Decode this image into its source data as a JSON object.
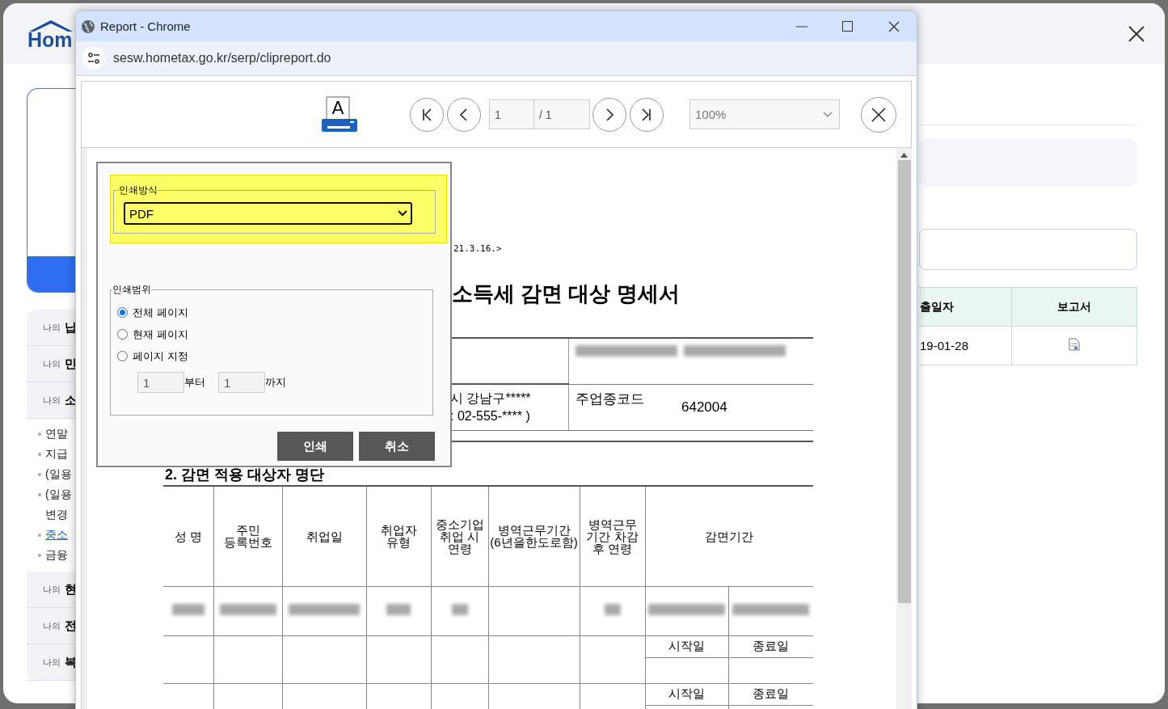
{
  "back_page": {
    "logo": "Hom",
    "nav": [
      {
        "prefix": "나의",
        "label": "납"
      },
      {
        "prefix": "나의",
        "label": "민"
      },
      {
        "prefix": "나의",
        "label": "소",
        "children": [
          {
            "kind": "text",
            "lines": [
              "연말"
            ]
          },
          {
            "kind": "text",
            "lines": [
              "지급"
            ]
          },
          {
            "kind": "text",
            "lines": [
              "(일용"
            ]
          },
          {
            "kind": "text",
            "lines": [
              "(일용",
              "변경"
            ]
          },
          {
            "kind": "link",
            "lines": [
              "중소"
            ]
          },
          {
            "kind": "text",
            "lines": [
              "금융"
            ]
          }
        ]
      },
      {
        "prefix": "나의",
        "label": "현"
      },
      {
        "prefix": "나의",
        "label": "전"
      },
      {
        "prefix": "나의",
        "label": "복"
      }
    ],
    "table": {
      "columns": [
        "출일자",
        "보고서"
      ],
      "rows": [
        {
          "date": "19-01-28"
        }
      ]
    }
  },
  "chrome": {
    "title": "Report - Chrome",
    "url": "sesw.hometax.go.kr/serp/clipreport.do"
  },
  "viewer": {
    "print_icon_letter": "A",
    "page": "1",
    "page_total": "/ 1",
    "zoom": "100%"
  },
  "report": {
    "revision": "21.3.16.>",
    "title": "소득세 감면 대상 명세서",
    "address": "시 강남구*****",
    "phone": ": 02-555-**** )",
    "industry_label": "주업종코드",
    "industry_code": "642004",
    "section_title": "2. 감면 적용 대상자 명단",
    "columns": [
      "성  명",
      "주민\n등록번호",
      "취업일",
      "취업자\n유형",
      "중소기업\n취업 시\n연령",
      "병역근무기간\n(6년을한도로함)",
      "병역근무\n기간 차감\n후 연령",
      "감면기간"
    ],
    "period_rows": [
      {
        "start": "시작일",
        "end": "종료일"
      },
      {
        "start": "시작일",
        "end": "종료일"
      }
    ]
  },
  "print_dialog": {
    "method_legend": "인쇄방식",
    "method": "PDF",
    "highlighted": true,
    "range_legend": "인쇄범위",
    "range_options": [
      {
        "label": "전체 페이지",
        "selected": true
      },
      {
        "label": "현재 페이지",
        "selected": false
      },
      {
        "label": "페이지 지정",
        "selected": false
      }
    ],
    "from": "1",
    "from_suffix": "부터",
    "to": "1",
    "to_suffix": "까지",
    "buttons": [
      "인쇄",
      "취소"
    ]
  }
}
